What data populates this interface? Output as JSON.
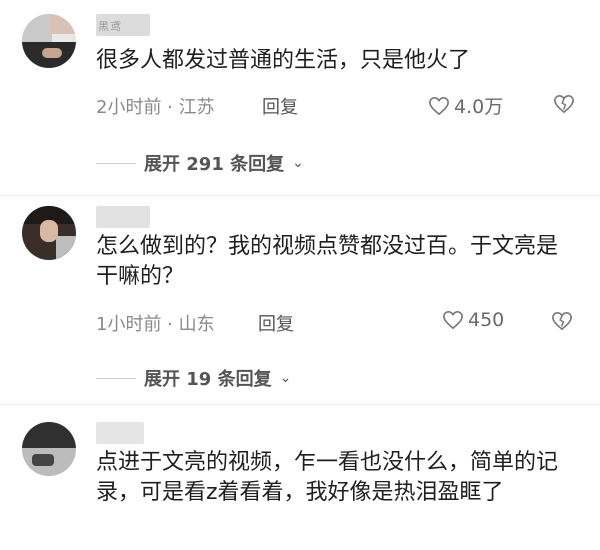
{
  "comments": [
    {
      "username_fragment": "黑鸢",
      "text": "很多人都发过普通的生活，只是他火了",
      "meta": "2小时前 · 江苏",
      "reply_label": "回复",
      "likes": "4.0万",
      "expand_label": "展开 291 条回复"
    },
    {
      "username_fragment": "",
      "text": "怎么做到的？我的视频点赞都没过百。于文亮是干嘛的？",
      "meta": "1小时前 · 山东",
      "reply_label": "回复",
      "likes": "450",
      "expand_label": "展开 19 条回复"
    },
    {
      "username_fragment": "",
      "text": "点进于文亮的视频，乍一看也没什么，简单的记录，可是看z着看着，我好像是热泪盈眶了",
      "meta": "",
      "reply_label": "",
      "likes": "",
      "expand_label": ""
    }
  ],
  "icons": {
    "like": "heart-outline-icon",
    "dislike": "broken-heart-icon",
    "expand": "chevron-down-icon"
  }
}
